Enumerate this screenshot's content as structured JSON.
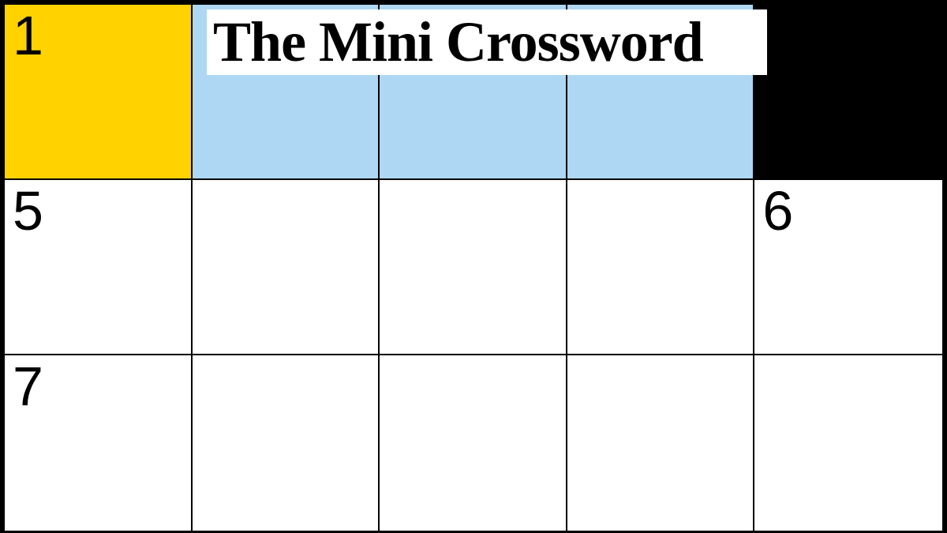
{
  "title": "The Mini Crossword",
  "grid": {
    "rows": 3,
    "cols": 5,
    "cells": [
      [
        {
          "num": "1",
          "fill": "yellow",
          "interactable": true
        },
        {
          "num": "",
          "fill": "blue",
          "interactable": true
        },
        {
          "num": "",
          "fill": "blue",
          "interactable": true
        },
        {
          "num": "",
          "fill": "blue",
          "interactable": true
        },
        {
          "num": "",
          "fill": "black",
          "interactable": false
        }
      ],
      [
        {
          "num": "5",
          "fill": "white",
          "interactable": true
        },
        {
          "num": "",
          "fill": "white",
          "interactable": true
        },
        {
          "num": "",
          "fill": "white",
          "interactable": true
        },
        {
          "num": "",
          "fill": "white",
          "interactable": true
        },
        {
          "num": "6",
          "fill": "white",
          "interactable": true
        }
      ],
      [
        {
          "num": "7",
          "fill": "white",
          "interactable": true
        },
        {
          "num": "",
          "fill": "white",
          "interactable": true
        },
        {
          "num": "",
          "fill": "white",
          "interactable": true
        },
        {
          "num": "",
          "fill": "white",
          "interactable": true
        },
        {
          "num": "",
          "fill": "white",
          "interactable": true
        }
      ]
    ]
  }
}
